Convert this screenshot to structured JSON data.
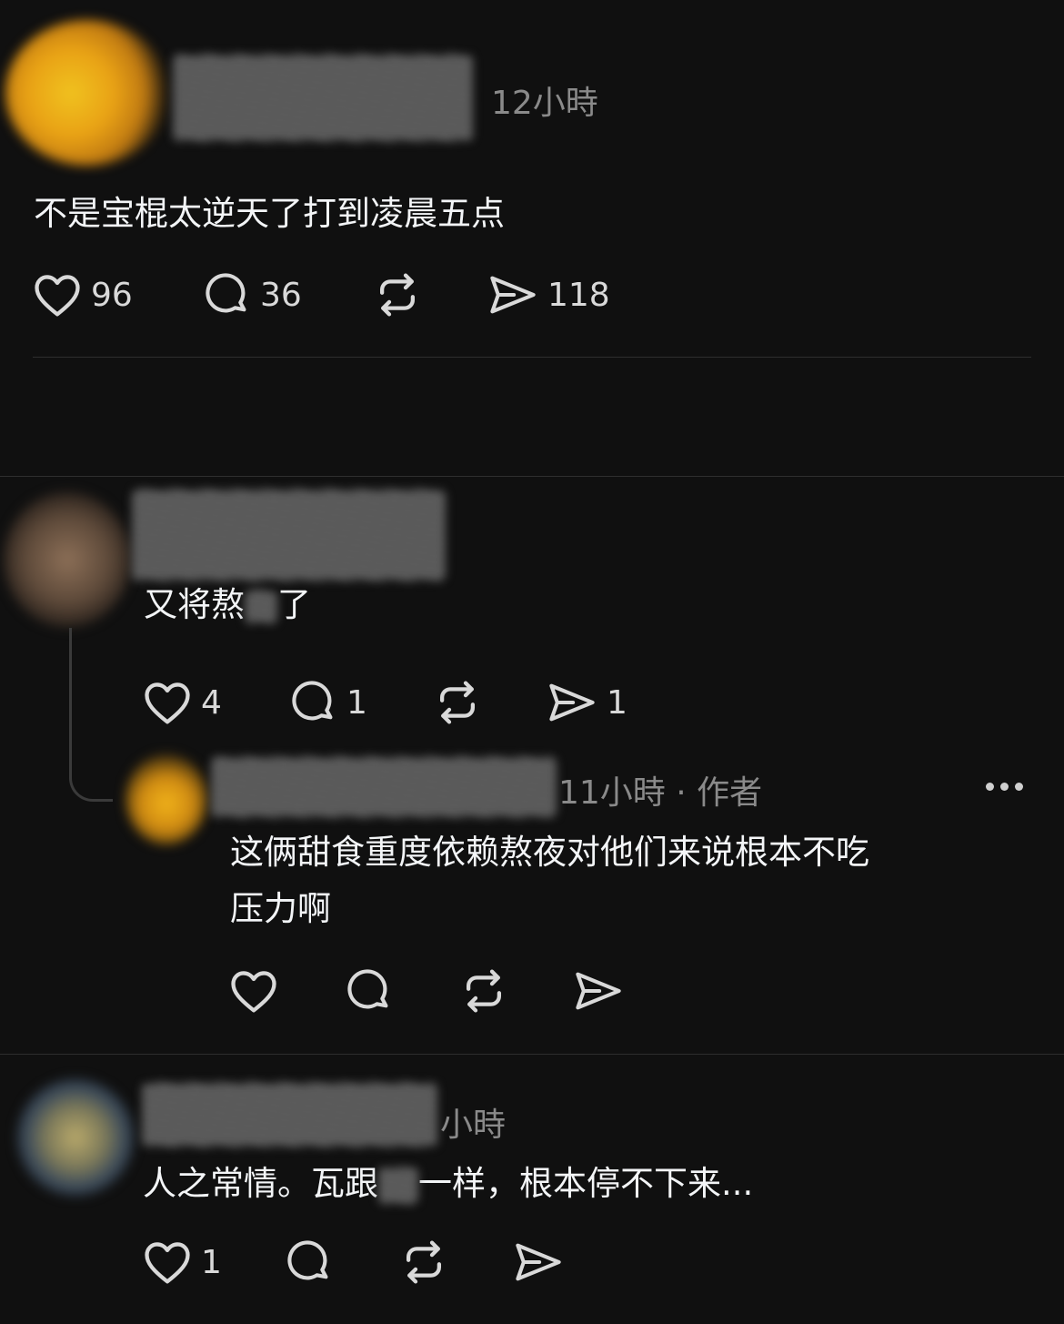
{
  "posts": [
    {
      "timestamp": "12小時",
      "text": "不是宝棍太逆天了打到凌晨五点",
      "likes": "96",
      "replies": "36",
      "shares": "118"
    },
    {
      "text": "又将熬",
      "text_end": "了",
      "likes": "4",
      "replies": "1",
      "shares": "1"
    },
    {
      "timestamp": "11小時 · 作者",
      "text_line1": "这俩甜食重度依赖熬夜对他们来说根本不吃",
      "text_line2": "压力啊"
    },
    {
      "timestamp": "小時",
      "text_a": "人之常情。瓦跟",
      "text_b": "一样，根本停不下来...",
      "likes": "1"
    }
  ],
  "icons": {
    "like": "heart-icon",
    "reply": "comment-icon",
    "repost": "repost-icon",
    "share": "send-icon",
    "more": "more-icon"
  },
  "colors": {
    "background": "#101010",
    "text": "#f3f5f7",
    "muted": "#8a8a8a"
  }
}
